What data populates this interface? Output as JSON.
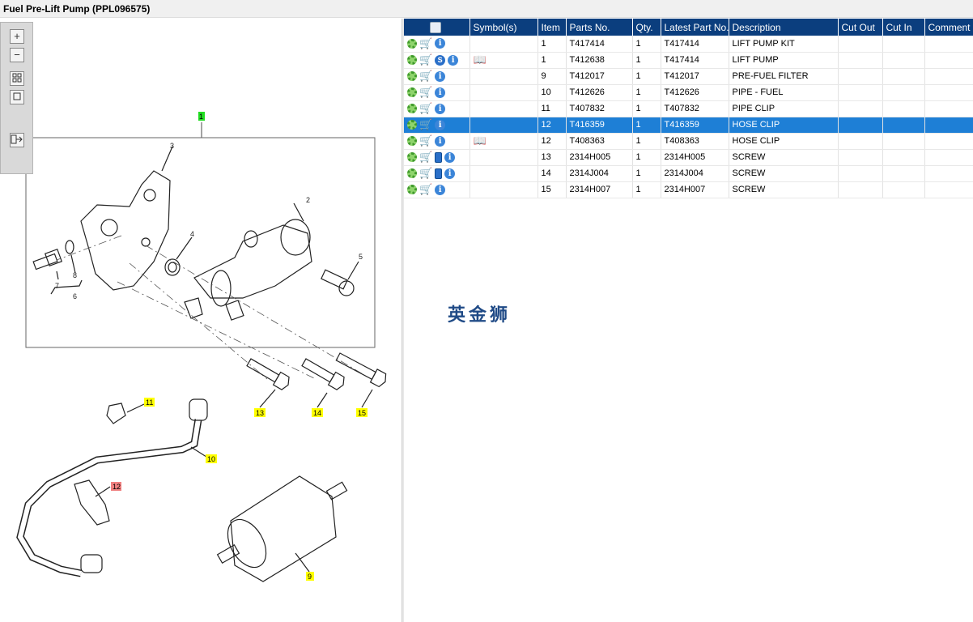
{
  "window": {
    "title": "Fuel Pre-Lift Pump (PPL096575)"
  },
  "toolbox": {
    "zoom_in": "+",
    "zoom_out": "−"
  },
  "diagram": {
    "callouts": {
      "c1": "1",
      "c2": "2",
      "c3": "3",
      "c4": "4",
      "c5": "5",
      "c6": "6",
      "c7": "7",
      "c8": "8",
      "c9": "9",
      "c10": "10",
      "c11": "11",
      "c12": "12",
      "c13": "13",
      "c14": "14",
      "c15": "15"
    }
  },
  "table": {
    "headers": [
      "",
      "Symbol(s)",
      "Item",
      "Parts No.",
      "Qty.",
      "Latest Part No.",
      "Description",
      "Cut Out",
      "Cut In",
      "Comment"
    ],
    "rows": [
      {
        "icons": [
          "gears-icon",
          "cart-icon",
          "info-icon"
        ],
        "symbol": "",
        "item": "1",
        "part": "T417414",
        "qty": "1",
        "latest": "T417414",
        "desc": "LIFT PUMP KIT",
        "cutout": "",
        "cutin": "",
        "comment": ""
      },
      {
        "icons": [
          "gears-icon",
          "cart-icon",
          "s-badge-icon",
          "info-icon"
        ],
        "symbol": "book-icon",
        "item": "1",
        "part": "T412638",
        "qty": "1",
        "latest": "T417414",
        "desc": "LIFT PUMP",
        "cutout": "",
        "cutin": "",
        "comment": ""
      },
      {
        "icons": [
          "gear-icon",
          "cart-icon",
          "info-icon"
        ],
        "symbol": "",
        "item": "9",
        "part": "T412017",
        "qty": "1",
        "latest": "T412017",
        "desc": "PRE-FUEL FILTER",
        "cutout": "",
        "cutin": "",
        "comment": ""
      },
      {
        "icons": [
          "gear-icon",
          "cart-icon",
          "info-icon"
        ],
        "symbol": "",
        "item": "10",
        "part": "T412626",
        "qty": "1",
        "latest": "T412626",
        "desc": "PIPE - FUEL",
        "cutout": "",
        "cutin": "",
        "comment": ""
      },
      {
        "icons": [
          "gear-icon",
          "cart-icon",
          "info-icon"
        ],
        "symbol": "",
        "item": "11",
        "part": "T407832",
        "qty": "1",
        "latest": "T407832",
        "desc": "PIPE CLIP",
        "cutout": "",
        "cutin": "",
        "comment": ""
      },
      {
        "icons": [
          "gear-icon",
          "cart-icon",
          "info-icon"
        ],
        "symbol": "",
        "item": "12",
        "part": "T416359",
        "qty": "1",
        "latest": "T416359",
        "desc": "HOSE CLIP",
        "cutout": "",
        "cutin": "",
        "comment": "",
        "selected": true
      },
      {
        "icons": [
          "gear-icon",
          "cart-icon",
          "info-icon"
        ],
        "symbol": "book-icon",
        "item": "12",
        "part": "T408363",
        "qty": "1",
        "latest": "T408363",
        "desc": "HOSE CLIP",
        "cutout": "",
        "cutin": "",
        "comment": ""
      },
      {
        "icons": [
          "gear-icon",
          "cart-icon",
          "phone-icon",
          "info-icon"
        ],
        "symbol": "",
        "item": "13",
        "part": "2314H005",
        "qty": "1",
        "latest": "2314H005",
        "desc": "SCREW",
        "cutout": "",
        "cutin": "",
        "comment": ""
      },
      {
        "icons": [
          "gear-icon",
          "cart-icon",
          "phone-icon",
          "info-icon"
        ],
        "symbol": "",
        "item": "14",
        "part": "2314J004",
        "qty": "1",
        "latest": "2314J004",
        "desc": "SCREW",
        "cutout": "",
        "cutin": "",
        "comment": ""
      },
      {
        "icons": [
          "gear-icon",
          "cart-icon",
          "info-icon"
        ],
        "symbol": "",
        "item": "15",
        "part": "2314H007",
        "qty": "1",
        "latest": "2314H007",
        "desc": "SCREW",
        "cutout": "",
        "cutin": "",
        "comment": ""
      }
    ]
  },
  "watermark": {
    "text": "英金狮"
  },
  "colors": {
    "header_bg": "#0b3e7e",
    "selected_row": "#1e7fd6",
    "callout_yellow": "#ffff00",
    "callout_green": "#22dd22",
    "callout_red": "#f08080"
  }
}
